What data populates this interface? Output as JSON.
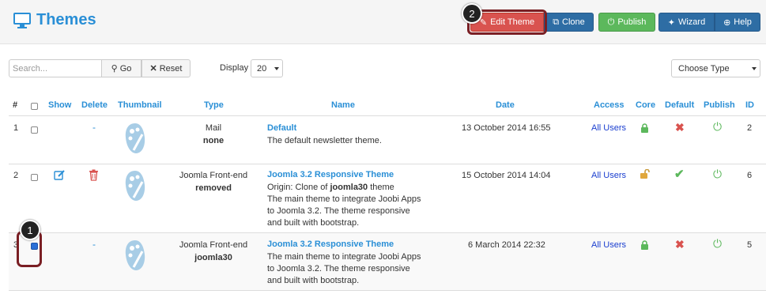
{
  "header": {
    "title": "Themes",
    "buttons": {
      "edit_theme": "Edit Theme",
      "clone": "Clone",
      "publish": "Publish",
      "wizard": "Wizard",
      "help": "Help"
    }
  },
  "callouts": {
    "one": "1",
    "two": "2"
  },
  "toolbar": {
    "search_placeholder": "Search...",
    "go_label": "Go",
    "reset_label": "Reset",
    "display_label": "Display",
    "display_value": "20",
    "type_filter": "Choose Type"
  },
  "table": {
    "columns": [
      "#",
      "Show",
      "Delete",
      "Thumbnail",
      "Type",
      "Name",
      "Date",
      "Access",
      "Core",
      "Default",
      "Publish",
      "ID"
    ],
    "rows": [
      {
        "num": "1",
        "type_line1": "Mail",
        "type_line2": "none",
        "name": "Default",
        "desc": [
          "The default newsletter theme."
        ],
        "date": "13 October 2014 16:55",
        "access": "All Users",
        "core": "locked",
        "default": "no",
        "publish": "on",
        "id": "2"
      },
      {
        "num": "2",
        "type_line1": "Joomla Front-end",
        "type_line2": "removed",
        "name": "Joomla 3.2 Responsive Theme",
        "desc": [
          "Origin: Clone of ",
          "joomla30",
          " theme",
          "The main theme to integrate Joobi Apps",
          "to Joomla 3.2. The theme responsive",
          "and built with bootstrap."
        ],
        "date": "15 October 2014 14:04",
        "access": "All Users",
        "core": "unlocked",
        "default": "yes",
        "publish": "on",
        "id": "6"
      },
      {
        "num": "3",
        "type_line1": "Joomla Front-end",
        "type_line2": "joomla30",
        "name": "Joomla 3.2 Responsive Theme",
        "desc": [
          "The main theme to integrate Joobi Apps",
          "to Joomla 3.2. The theme responsive",
          "and built with bootstrap."
        ],
        "date": "6 March 2014 22:32",
        "access": "All Users",
        "core": "locked",
        "default": "no",
        "publish": "on",
        "id": "5"
      }
    ]
  },
  "colors": {
    "link": "#2a8fd6",
    "danger": "#d9534f",
    "success": "#5cb85c",
    "primary": "#2e6da4",
    "callout_ring": "#7a1f24"
  },
  "icons": [
    "monitor-icon",
    "edit-icon",
    "clone-icon",
    "publish-icon",
    "wand-icon",
    "help-icon",
    "search-icon",
    "close-icon",
    "lock-icon",
    "unlock-icon",
    "cross-icon",
    "check-icon",
    "power-icon",
    "trash-icon",
    "palette-icon"
  ],
  "dash": "-"
}
